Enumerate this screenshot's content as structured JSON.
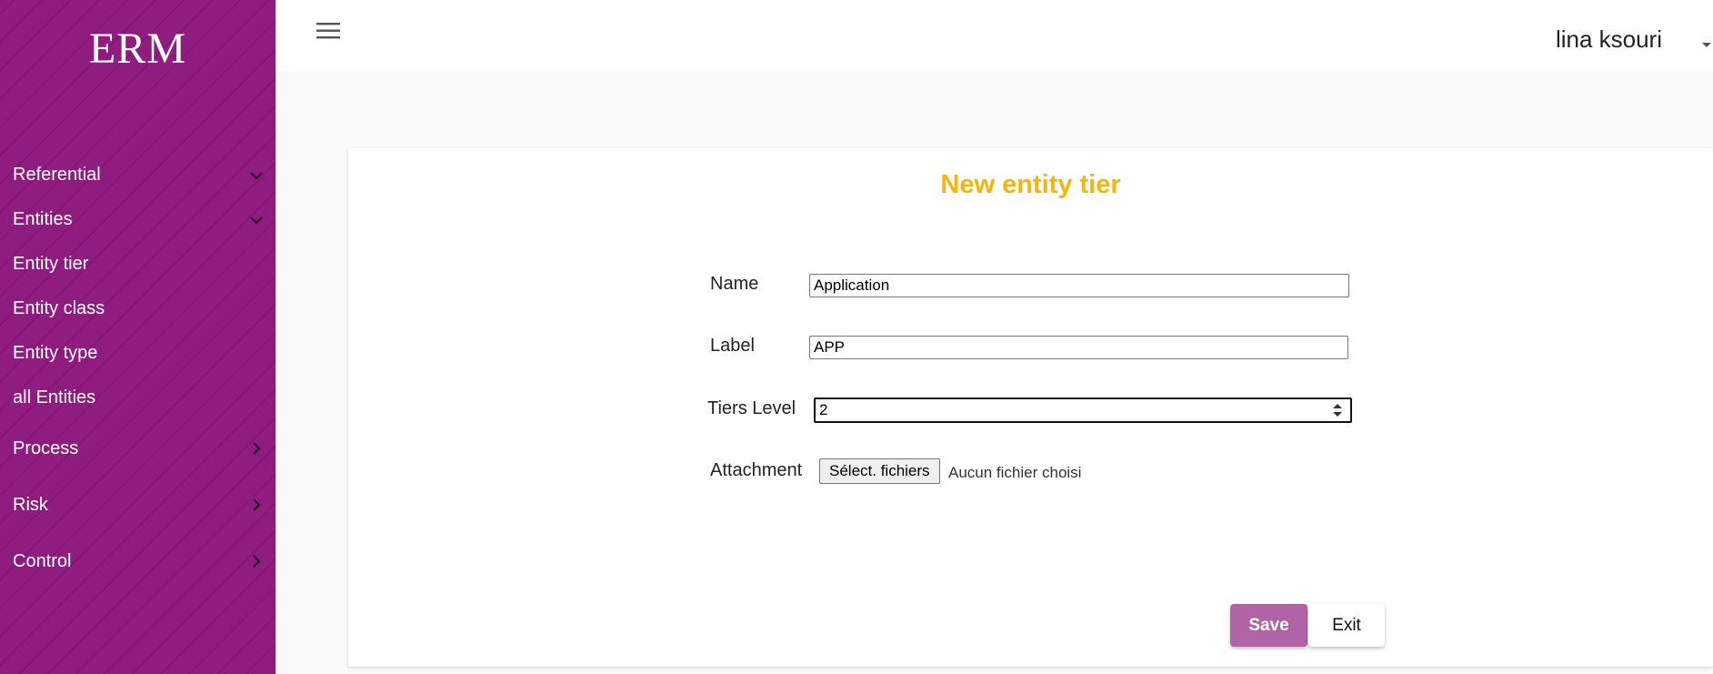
{
  "brand": "ERM",
  "sidebar": {
    "items": [
      {
        "label": "Referential",
        "chevron": "chevron-down-icon"
      },
      {
        "label": "Entities",
        "chevron": "chevron-down-icon"
      },
      {
        "label": "Entity tier"
      },
      {
        "label": "Entity class"
      },
      {
        "label": "Entity type"
      },
      {
        "label": "all Entities"
      },
      {
        "label": "Process",
        "chevron": "chevron-right-icon"
      },
      {
        "label": "Risk",
        "chevron": "chevron-right-icon"
      },
      {
        "label": "Control",
        "chevron": "chevron-right-icon"
      }
    ]
  },
  "header": {
    "menu_icon": "hamburger-icon",
    "user_name": "lina ksouri",
    "user_menu_icon": "caret-down-icon"
  },
  "form": {
    "title": "New entity tier",
    "name_label": "Name",
    "name_value": "Application",
    "label_label": "Label",
    "label_value": "APP",
    "tiers_label": "Tiers Level",
    "tiers_value": "2",
    "attachment_label": "Attachment",
    "file_button": "Sélect. fichiers",
    "file_status": "Aucun fichier choisi",
    "save_label": "Save",
    "exit_label": "Exit"
  },
  "colors": {
    "sidebar": "#8f1d80",
    "title": "#f5b60c",
    "save_button": "#b064a5"
  }
}
